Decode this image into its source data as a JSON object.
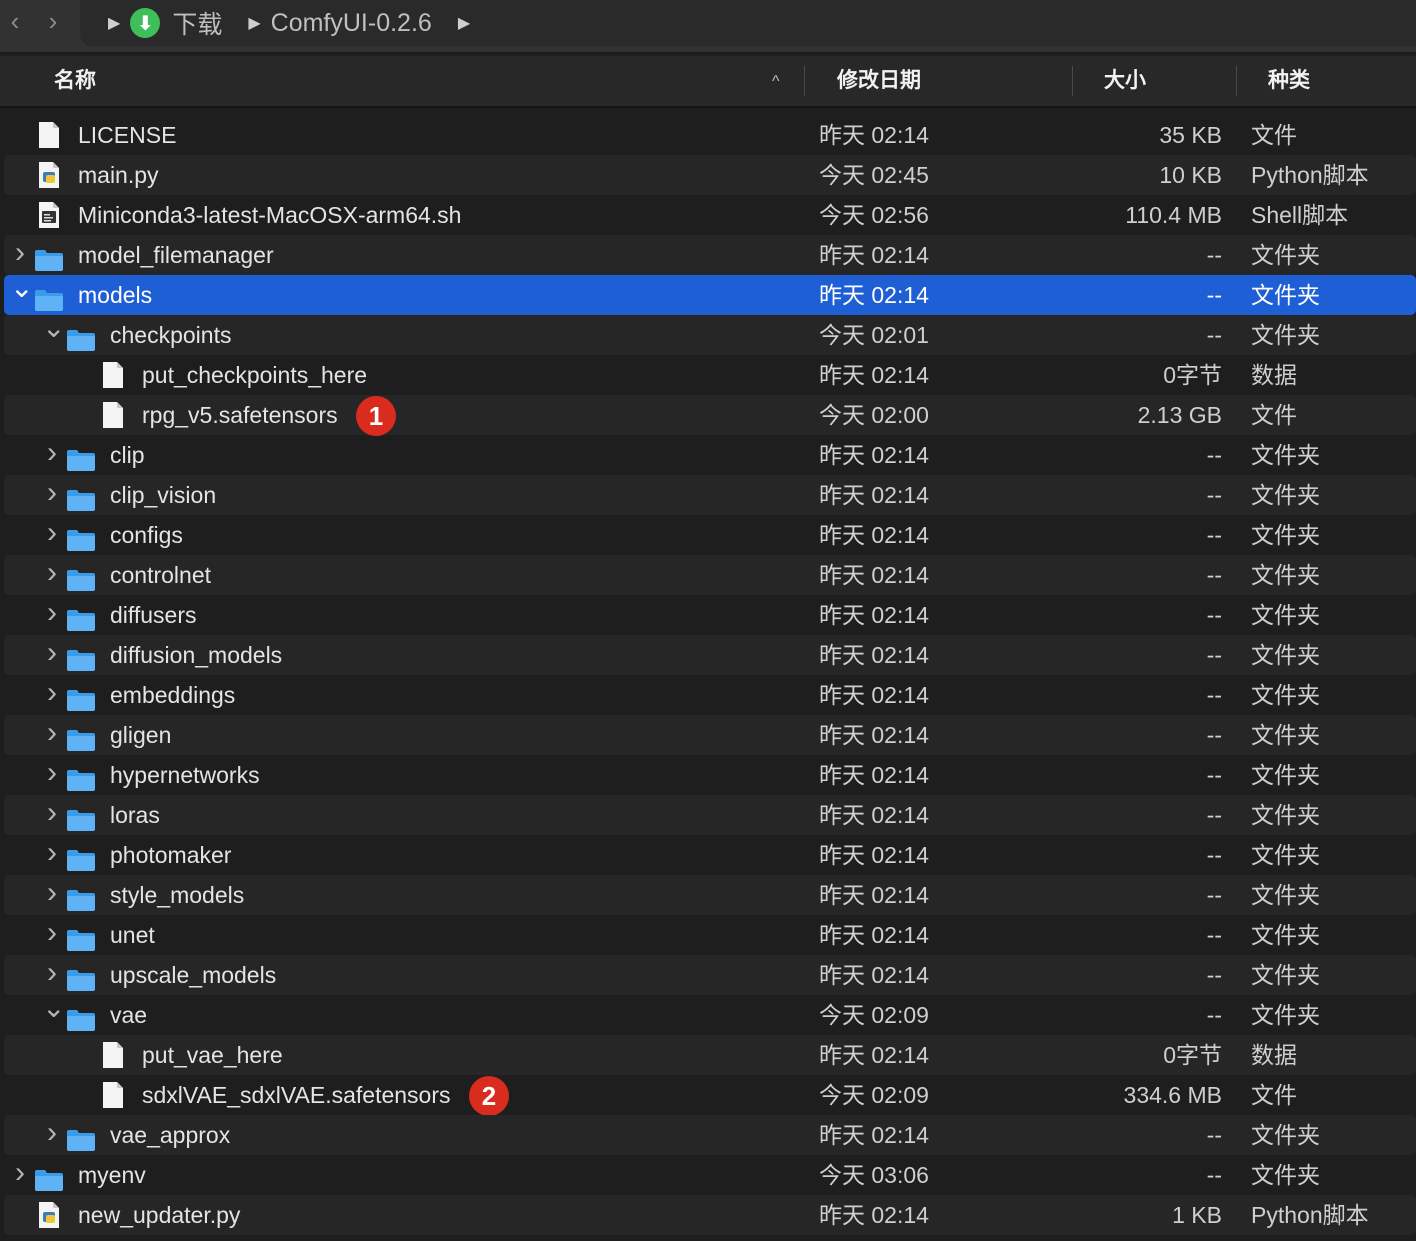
{
  "toolbar": {
    "back_glyph": "‹",
    "forward_glyph": "›",
    "path": [
      "下载",
      "ComfyUI-0.2.6"
    ],
    "path_icons": [
      "download-icon"
    ]
  },
  "columns": {
    "name": "名称",
    "date": "修改日期",
    "size": "大小",
    "kind": "种类",
    "sort_indicator": "^"
  },
  "colors": {
    "selection": "#1f5fd6",
    "folder": "#3a9bea",
    "badge": "#d92b1e",
    "download": "#3fbf5a"
  },
  "rows": [
    {
      "name": "LICENSE",
      "date": "昨天 02:14",
      "size": "35 KB",
      "kind": "文件",
      "type": "file",
      "level": 0
    },
    {
      "name": "main.py",
      "date": "今天 02:45",
      "size": "10 KB",
      "kind": "Python脚本",
      "type": "python",
      "level": 0
    },
    {
      "name": "Miniconda3-latest-MacOSX-arm64.sh",
      "date": "今天 02:56",
      "size": "110.4 MB",
      "kind": "Shell脚本",
      "type": "script",
      "level": 0
    },
    {
      "name": "model_filemanager",
      "date": "昨天 02:14",
      "size": "--",
      "kind": "文件夹",
      "type": "folder",
      "level": 0,
      "expanded": false
    },
    {
      "name": "models",
      "date": "昨天 02:14",
      "size": "--",
      "kind": "文件夹",
      "type": "folder",
      "level": 0,
      "expanded": true,
      "selected": true
    },
    {
      "name": "checkpoints",
      "date": "今天 02:01",
      "size": "--",
      "kind": "文件夹",
      "type": "folder",
      "level": 1,
      "expanded": true
    },
    {
      "name": "put_checkpoints_here",
      "date": "昨天 02:14",
      "size": "0字节",
      "kind": "数据",
      "type": "file",
      "level": 2
    },
    {
      "name": "rpg_v5.safetensors",
      "date": "今天 02:00",
      "size": "2.13 GB",
      "kind": "文件",
      "type": "file",
      "level": 2,
      "badge": "1"
    },
    {
      "name": "clip",
      "date": "昨天 02:14",
      "size": "--",
      "kind": "文件夹",
      "type": "folder",
      "level": 1,
      "expanded": false
    },
    {
      "name": "clip_vision",
      "date": "昨天 02:14",
      "size": "--",
      "kind": "文件夹",
      "type": "folder",
      "level": 1,
      "expanded": false
    },
    {
      "name": "configs",
      "date": "昨天 02:14",
      "size": "--",
      "kind": "文件夹",
      "type": "folder",
      "level": 1,
      "expanded": false
    },
    {
      "name": "controlnet",
      "date": "昨天 02:14",
      "size": "--",
      "kind": "文件夹",
      "type": "folder",
      "level": 1,
      "expanded": false
    },
    {
      "name": "diffusers",
      "date": "昨天 02:14",
      "size": "--",
      "kind": "文件夹",
      "type": "folder",
      "level": 1,
      "expanded": false
    },
    {
      "name": "diffusion_models",
      "date": "昨天 02:14",
      "size": "--",
      "kind": "文件夹",
      "type": "folder",
      "level": 1,
      "expanded": false
    },
    {
      "name": "embeddings",
      "date": "昨天 02:14",
      "size": "--",
      "kind": "文件夹",
      "type": "folder",
      "level": 1,
      "expanded": false
    },
    {
      "name": "gligen",
      "date": "昨天 02:14",
      "size": "--",
      "kind": "文件夹",
      "type": "folder",
      "level": 1,
      "expanded": false
    },
    {
      "name": "hypernetworks",
      "date": "昨天 02:14",
      "size": "--",
      "kind": "文件夹",
      "type": "folder",
      "level": 1,
      "expanded": false
    },
    {
      "name": "loras",
      "date": "昨天 02:14",
      "size": "--",
      "kind": "文件夹",
      "type": "folder",
      "level": 1,
      "expanded": false
    },
    {
      "name": "photomaker",
      "date": "昨天 02:14",
      "size": "--",
      "kind": "文件夹",
      "type": "folder",
      "level": 1,
      "expanded": false
    },
    {
      "name": "style_models",
      "date": "昨天 02:14",
      "size": "--",
      "kind": "文件夹",
      "type": "folder",
      "level": 1,
      "expanded": false
    },
    {
      "name": "unet",
      "date": "昨天 02:14",
      "size": "--",
      "kind": "文件夹",
      "type": "folder",
      "level": 1,
      "expanded": false
    },
    {
      "name": "upscale_models",
      "date": "昨天 02:14",
      "size": "--",
      "kind": "文件夹",
      "type": "folder",
      "level": 1,
      "expanded": false
    },
    {
      "name": "vae",
      "date": "今天 02:09",
      "size": "--",
      "kind": "文件夹",
      "type": "folder",
      "level": 1,
      "expanded": true
    },
    {
      "name": "put_vae_here",
      "date": "昨天 02:14",
      "size": "0字节",
      "kind": "数据",
      "type": "file",
      "level": 2
    },
    {
      "name": "sdxlVAE_sdxlVAE.safetensors",
      "date": "今天 02:09",
      "size": "334.6 MB",
      "kind": "文件",
      "type": "file",
      "level": 2,
      "badge": "2"
    },
    {
      "name": "vae_approx",
      "date": "昨天 02:14",
      "size": "--",
      "kind": "文件夹",
      "type": "folder",
      "level": 1,
      "expanded": false
    },
    {
      "name": "myenv",
      "date": "今天 03:06",
      "size": "--",
      "kind": "文件夹",
      "type": "folder",
      "level": 0,
      "expanded": false
    },
    {
      "name": "new_updater.py",
      "date": "昨天 02:14",
      "size": "1 KB",
      "kind": "Python脚本",
      "type": "python",
      "level": 0
    }
  ]
}
